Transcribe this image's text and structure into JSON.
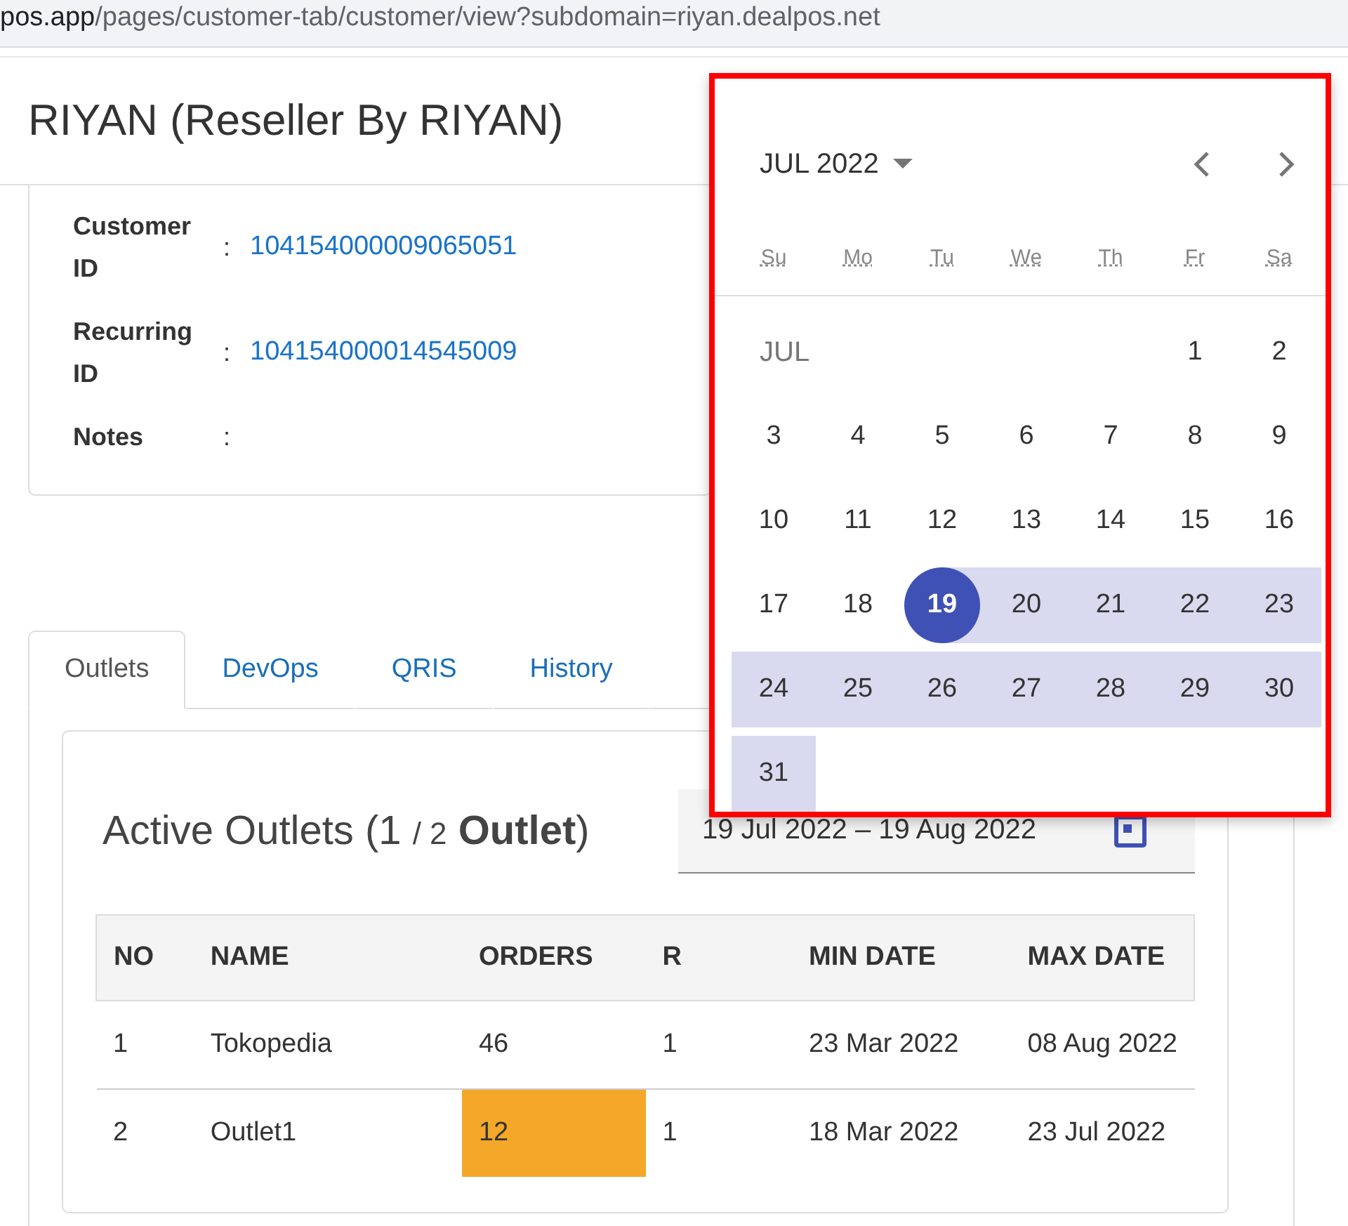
{
  "address_bar": {
    "host": "pos.app",
    "path": "/pages/customer-tab/customer/view?subdomain=riyan.dealpos.net"
  },
  "page_title": "RIYAN (Reseller By RIYAN)",
  "details": [
    {
      "label": "Customer ID",
      "separator": ":",
      "value": "104154000009065051"
    },
    {
      "label": "Recurring ID",
      "separator": ":",
      "value": "104154000014545009"
    },
    {
      "label": "Notes",
      "separator": ":"
    }
  ],
  "tabs": [
    {
      "label": "Outlets",
      "selected": true
    },
    {
      "label": "DevOps",
      "selected": false
    },
    {
      "label": "QRIS",
      "selected": false
    },
    {
      "label": "History",
      "selected": false
    }
  ],
  "outlets": {
    "heading": "Active Outlets (1",
    "count_total": "/ 2",
    "heading_bold": "Outlet",
    "heading_end": ")",
    "date_range": "19 Jul 2022 – 19 Aug 2022",
    "table": {
      "columns": [
        "NO",
        "NAME",
        "ORDERS",
        "R",
        "MIN DATE",
        "MAX DATE"
      ],
      "rows": [
        {
          "cells": [
            "1",
            "Tokopedia",
            "46",
            "1",
            "23 Mar 2022",
            "08 Aug 2022"
          ],
          "orders_highlighted": false
        },
        {
          "cells": [
            "2",
            "Outlet1",
            "12",
            "1",
            "18 Mar 2022",
            "23 Jul 2022"
          ],
          "orders_highlighted": true
        }
      ]
    }
  },
  "calendar": {
    "month_year": "JUL 2022",
    "weekdays": [
      "Su",
      "Mo",
      "Tu",
      "We",
      "Th",
      "Fr",
      "Sa"
    ],
    "month_label": "JUL",
    "weeks": [
      [
        {
          "day": "1",
          "selected": false,
          "in_range": false
        },
        {
          "day": "2",
          "selected": false,
          "in_range": false
        }
      ],
      [
        {
          "day": "3",
          "selected": false,
          "in_range": false
        },
        {
          "day": "4",
          "selected": false,
          "in_range": false
        },
        {
          "day": "5",
          "selected": false,
          "in_range": false
        },
        {
          "day": "6",
          "selected": false,
          "in_range": false
        },
        {
          "day": "7",
          "selected": false,
          "in_range": false
        },
        {
          "day": "8",
          "selected": false,
          "in_range": false
        },
        {
          "day": "9",
          "selected": false,
          "in_range": false
        }
      ],
      [
        {
          "day": "10",
          "selected": false,
          "in_range": false
        },
        {
          "day": "11",
          "selected": false,
          "in_range": false
        },
        {
          "day": "12",
          "selected": false,
          "in_range": false
        },
        {
          "day": "13",
          "selected": false,
          "in_range": false
        },
        {
          "day": "14",
          "selected": false,
          "in_range": false
        },
        {
          "day": "15",
          "selected": false,
          "in_range": false
        },
        {
          "day": "16",
          "selected": false,
          "in_range": false
        }
      ],
      [
        {
          "day": "17",
          "selected": false,
          "in_range": false
        },
        {
          "day": "18",
          "selected": false,
          "in_range": false
        },
        {
          "day": "19",
          "selected": true,
          "in_range": true
        },
        {
          "day": "20",
          "selected": false,
          "in_range": true
        },
        {
          "day": "21",
          "selected": false,
          "in_range": true
        },
        {
          "day": "22",
          "selected": false,
          "in_range": true
        },
        {
          "day": "23",
          "selected": false,
          "in_range": true
        }
      ],
      [
        {
          "day": "24",
          "selected": false,
          "in_range": true
        },
        {
          "day": "25",
          "selected": false,
          "in_range": true
        },
        {
          "day": "26",
          "selected": false,
          "in_range": true
        },
        {
          "day": "27",
          "selected": false,
          "in_range": true
        },
        {
          "day": "28",
          "selected": false,
          "in_range": true
        },
        {
          "day": "29",
          "selected": false,
          "in_range": true
        },
        {
          "day": "30",
          "selected": false,
          "in_range": true
        }
      ],
      [
        {
          "day": "31",
          "selected": false,
          "in_range": true
        }
      ]
    ]
  }
}
